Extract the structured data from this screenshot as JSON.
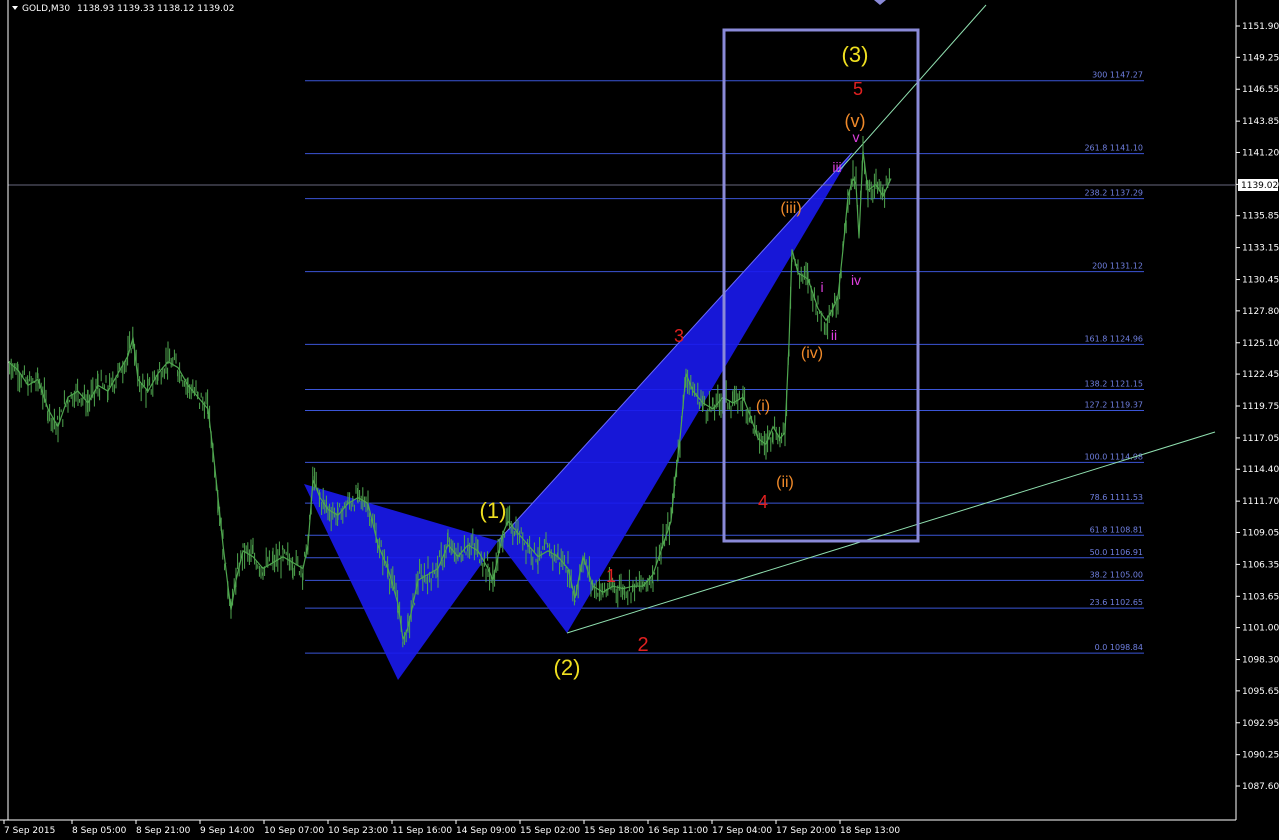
{
  "header": {
    "symbol": "GOLD,M30",
    "ohlc": "1138.93 1139.33 1138.12 1139.02"
  },
  "current_price": "1139.02",
  "colors": {
    "background": "#000000",
    "candles": "#4fa64f",
    "fib": "#3b55d6",
    "fib_text": "#6f7fe0",
    "pattern": "#1a1aee",
    "trend": "#90e0b0",
    "box": "#8a8ad8"
  },
  "chart_data": {
    "type": "line",
    "price_axis": {
      "ticks": [
        "1151.90",
        "1149.25",
        "1146.55",
        "1143.85",
        "1141.20",
        "1138.50",
        "1135.85",
        "1133.15",
        "1130.45",
        "1127.80",
        "1125.10",
        "1122.45",
        "1119.75",
        "1117.05",
        "1114.40",
        "1111.70",
        "1109.05",
        "1106.35",
        "1103.65",
        "1101.00",
        "1098.30",
        "1095.65",
        "1092.95",
        "1090.25",
        "1087.60"
      ],
      "ylim": [
        1086.3,
        1154.7
      ]
    },
    "time_axis": {
      "labels": [
        "7 Sep 2015",
        "8 Sep 05:00",
        "8 Sep 21:00",
        "9 Sep 14:00",
        "10 Sep 07:00",
        "10 Sep 23:00",
        "11 Sep 16:00",
        "14 Sep 09:00",
        "15 Sep 02:00",
        "15 Sep 18:00",
        "16 Sep 11:00",
        "17 Sep 04:00",
        "17 Sep 20:00",
        "18 Sep 13:00"
      ]
    },
    "price_series": [
      [
        0,
        1123.5
      ],
      [
        10,
        1122.8
      ],
      [
        20,
        1121.5
      ],
      [
        30,
        1122
      ],
      [
        40,
        1119.5
      ],
      [
        50,
        1118
      ],
      [
        60,
        1120.5
      ],
      [
        70,
        1121
      ],
      [
        80,
        1120
      ],
      [
        90,
        1121.5
      ],
      [
        100,
        1121
      ],
      [
        110,
        1122.5
      ],
      [
        120,
        1124
      ],
      [
        125,
        1125.5
      ],
      [
        130,
        1122
      ],
      [
        140,
        1121
      ],
      [
        150,
        1122.5
      ],
      [
        160,
        1123.5
      ],
      [
        170,
        1123
      ],
      [
        180,
        1121.5
      ],
      [
        190,
        1120.5
      ],
      [
        200,
        1119.5
      ],
      [
        205,
        1116
      ],
      [
        210,
        1112
      ],
      [
        215,
        1108
      ],
      [
        220,
        1104.5
      ],
      [
        223,
        1102.5
      ],
      [
        228,
        1105
      ],
      [
        235,
        1107.5
      ],
      [
        245,
        1107
      ],
      [
        255,
        1106
      ],
      [
        265,
        1106.5
      ],
      [
        275,
        1107
      ],
      [
        285,
        1106.5
      ],
      [
        295,
        1106
      ],
      [
        300,
        1108
      ],
      [
        305,
        1113.5
      ],
      [
        312,
        1112
      ],
      [
        320,
        1111
      ],
      [
        330,
        1110.5
      ],
      [
        340,
        1111.5
      ],
      [
        350,
        1112
      ],
      [
        360,
        1111.5
      ],
      [
        370,
        1108
      ],
      [
        380,
        1106
      ],
      [
        390,
        1103
      ],
      [
        395,
        1100
      ],
      [
        400,
        1101
      ],
      [
        405,
        1103
      ],
      [
        410,
        1105
      ],
      [
        420,
        1105.5
      ],
      [
        430,
        1106
      ],
      [
        440,
        1108
      ],
      [
        450,
        1107
      ],
      [
        460,
        1108
      ],
      [
        470,
        1107.5
      ],
      [
        480,
        1106
      ],
      [
        485,
        1105
      ],
      [
        490,
        1107
      ],
      [
        495,
        1109
      ],
      [
        500,
        1110
      ],
      [
        510,
        1109
      ],
      [
        520,
        1108
      ],
      [
        530,
        1107
      ],
      [
        540,
        1107.5
      ],
      [
        550,
        1107
      ],
      [
        560,
        1106
      ],
      [
        567,
        1103.5
      ],
      [
        575,
        1107
      ],
      [
        585,
        1104.5
      ],
      [
        595,
        1104
      ],
      [
        605,
        1104.5
      ],
      [
        615,
        1104.3
      ],
      [
        625,
        1104.5
      ],
      [
        635,
        1104.5
      ],
      [
        645,
        1105.5
      ],
      [
        655,
        1108
      ],
      [
        663,
        1110
      ],
      [
        667,
        1113.5
      ],
      [
        672,
        1117
      ],
      [
        678,
        1122.5
      ],
      [
        685,
        1121
      ],
      [
        695,
        1120
      ],
      [
        705,
        1119.5
      ],
      [
        715,
        1120.5
      ],
      [
        725,
        1120
      ],
      [
        735,
        1120.5
      ],
      [
        742,
        1119
      ],
      [
        750,
        1117
      ],
      [
        758,
        1116.5
      ],
      [
        765,
        1118
      ],
      [
        772,
        1117
      ],
      [
        777,
        1117.5
      ],
      [
        781,
        1125
      ],
      [
        784,
        1133
      ],
      [
        790,
        1131
      ],
      [
        800,
        1130.5
      ],
      [
        810,
        1128
      ],
      [
        818,
        1127
      ],
      [
        825,
        1128
      ],
      [
        830,
        1129
      ],
      [
        835,
        1133
      ],
      [
        840,
        1137.5
      ],
      [
        845,
        1139
      ],
      [
        848,
        1138.5
      ],
      [
        851,
        1134
      ],
      [
        855,
        1141.3
      ],
      [
        860,
        1138
      ],
      [
        868,
        1138.5
      ],
      [
        875,
        1137.5
      ],
      [
        883,
        1139
      ]
    ],
    "fibonacci_levels": [
      {
        "level": "300",
        "price": "1147.27"
      },
      {
        "level": "261.8",
        "price": "1141.10"
      },
      {
        "level": "238.2",
        "price": "1137.29"
      },
      {
        "level": "200",
        "price": "1131.12"
      },
      {
        "level": "161.8",
        "price": "1124.96"
      },
      {
        "level": "138.2",
        "price": "1121.15"
      },
      {
        "level": "127.2",
        "price": "1119.37"
      },
      {
        "level": "100.0",
        "price": "1114.98"
      },
      {
        "level": "78.6",
        "price": "1111.53"
      },
      {
        "level": "61.8",
        "price": "1108.81"
      },
      {
        "level": "50.0",
        "price": "1106.91"
      },
      {
        "level": "38.2",
        "price": "1105.00"
      },
      {
        "level": "23.6",
        "price": "1102.65"
      },
      {
        "level": "0.0",
        "price": "1098.84"
      }
    ],
    "wave_labels": [
      {
        "text": "(3)",
        "color": "#f0e020"
      },
      {
        "text": "5",
        "color": "#e02020"
      },
      {
        "text": "(v)",
        "color": "#f08a2a"
      },
      {
        "text": "v",
        "color": "#e040e0"
      },
      {
        "text": "iii",
        "color": "#e040e0"
      },
      {
        "text": "(iii)",
        "color": "#f08a2a"
      },
      {
        "text": "iv",
        "color": "#e040e0"
      },
      {
        "text": "i",
        "color": "#e040e0"
      },
      {
        "text": "ii",
        "color": "#e040e0"
      },
      {
        "text": "(iv)",
        "color": "#f08a2a"
      },
      {
        "text": "3",
        "color": "#e02020"
      },
      {
        "text": "(i)",
        "color": "#f08a2a"
      },
      {
        "text": "(ii)",
        "color": "#f08a2a"
      },
      {
        "text": "4",
        "color": "#e02020"
      },
      {
        "text": "(1)",
        "color": "#f0e020"
      },
      {
        "text": "1",
        "color": "#e02020"
      },
      {
        "text": "2",
        "color": "#e02020"
      },
      {
        "text": "(2)",
        "color": "#f0e020"
      }
    ]
  }
}
